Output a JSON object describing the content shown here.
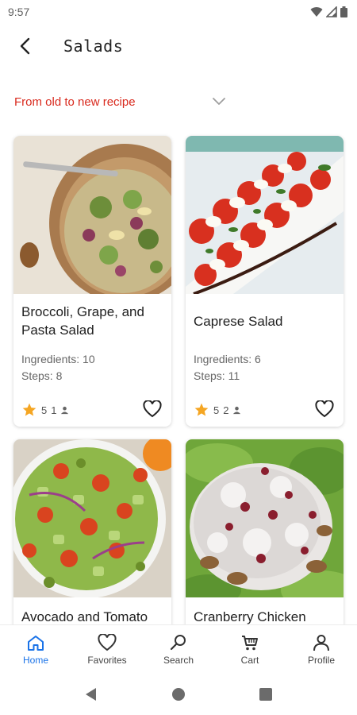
{
  "status_bar": {
    "time": "9:57"
  },
  "header": {
    "title": "Salads"
  },
  "sort": {
    "label": "From old to new recipe"
  },
  "recipes": [
    {
      "title": "Broccoli, Grape, and Pasta Salad",
      "ingredients": "Ingredients: 10",
      "steps": "Steps: 8",
      "rating": "5",
      "reviews": "1"
    },
    {
      "title": "Caprese Salad",
      "ingredients": "Ingredients: 6",
      "steps": "Steps: 11",
      "rating": "5",
      "reviews": "2"
    },
    {
      "title": "Avocado and Tomato"
    },
    {
      "title": "Cranberry Chicken"
    }
  ],
  "bottom_nav": [
    {
      "label": "Home",
      "icon": "home-icon",
      "active": true
    },
    {
      "label": "Favorites",
      "icon": "heart-icon"
    },
    {
      "label": "Search",
      "icon": "search-icon"
    },
    {
      "label": "Cart",
      "icon": "cart-icon"
    },
    {
      "label": "Profile",
      "icon": "person-icon"
    }
  ],
  "colors": {
    "accent": "#d92a1e",
    "active_nav": "#1a73e8",
    "star": "#f5a623"
  }
}
